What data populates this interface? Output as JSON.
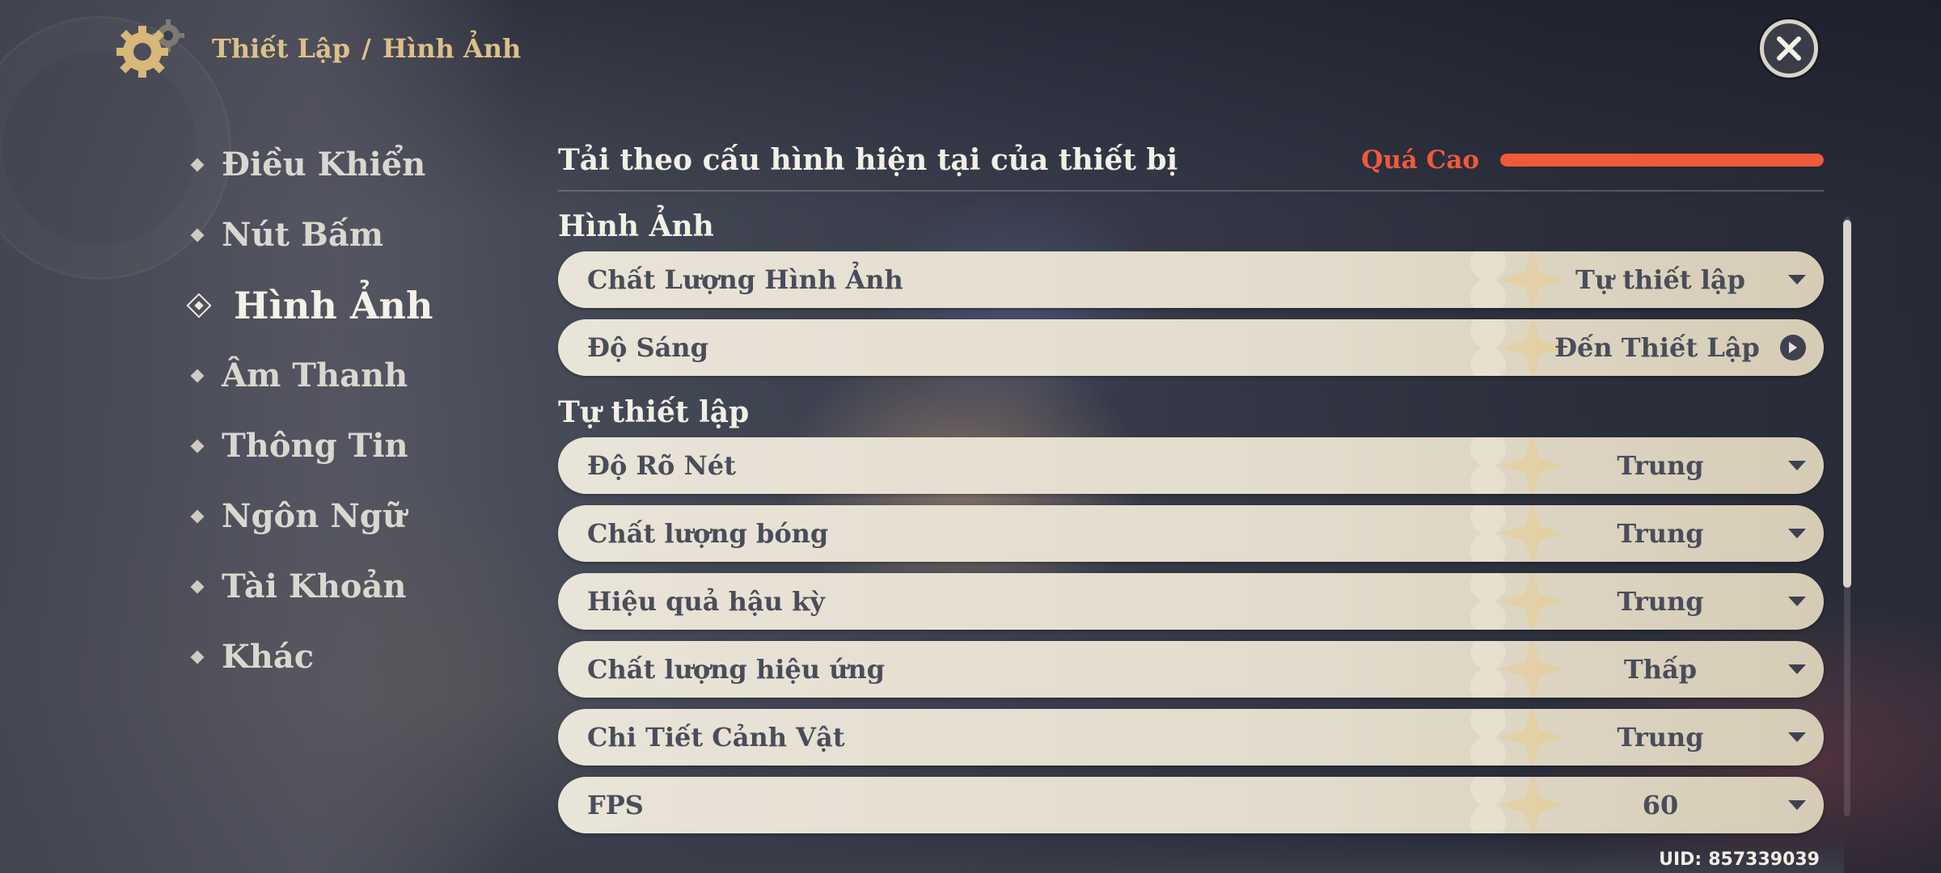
{
  "header": {
    "section": "Thiết Lập",
    "separator": "/",
    "page": "Hình Ảnh"
  },
  "sidebar": {
    "items": [
      {
        "label": "Điều Khiển",
        "active": false
      },
      {
        "label": "Nút Bấm",
        "active": false
      },
      {
        "label": "Hình Ảnh",
        "active": true
      },
      {
        "label": "Âm Thanh",
        "active": false
      },
      {
        "label": "Thông Tin",
        "active": false
      },
      {
        "label": "Ngôn Ngữ",
        "active": false
      },
      {
        "label": "Tài Khoản",
        "active": false
      },
      {
        "label": "Khác",
        "active": false
      }
    ]
  },
  "device_load": {
    "label": "Tải theo cấu hình hiện tại của thiết bị",
    "level": "Quá Cao",
    "level_fraction": 1.0,
    "color": "#f0593c"
  },
  "graphics": {
    "title": "Hình Ảnh",
    "rows": [
      {
        "name": "Chất Lượng Hình Ảnh",
        "value": "Tự thiết lập",
        "control": "dropdown"
      },
      {
        "name": "Độ Sáng",
        "value": "Đến Thiết Lập",
        "control": "link"
      }
    ]
  },
  "custom": {
    "title": "Tự thiết lập",
    "rows": [
      {
        "name": "Độ Rõ Nét",
        "value": "Trung",
        "control": "dropdown"
      },
      {
        "name": "Chất lượng bóng",
        "value": "Trung",
        "control": "dropdown"
      },
      {
        "name": "Hiệu quả hậu kỳ",
        "value": "Trung",
        "control": "dropdown"
      },
      {
        "name": "Chất lượng hiệu ứng",
        "value": "Thấp",
        "control": "dropdown"
      },
      {
        "name": "Chi Tiết Cảnh Vật",
        "value": "Trung",
        "control": "dropdown"
      },
      {
        "name": "FPS",
        "value": "60",
        "control": "dropdown"
      }
    ]
  },
  "footer": {
    "uid_label": "UID:",
    "uid_value": "857339039"
  },
  "icons": {
    "settings": "gear-icon",
    "close": "close-icon",
    "dropdown": "caret-down-icon",
    "link": "arrow-right-circle-icon"
  },
  "colors": {
    "accent_gold": "#dcc08a",
    "warning": "#f0593c",
    "row_text": "#4a4d5a"
  }
}
